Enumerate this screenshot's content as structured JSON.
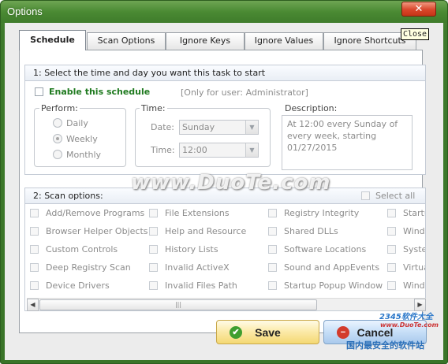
{
  "window": {
    "title": "Options",
    "close_symbol": "✕",
    "tooltip": "Close"
  },
  "tabs": [
    {
      "label": "Schedule",
      "active": true
    },
    {
      "label": "Scan Options"
    },
    {
      "label": "Ignore Keys"
    },
    {
      "label": "Ignore Values"
    },
    {
      "label": "Ignore Shortcuts"
    }
  ],
  "schedule": {
    "section_title": "1: Select the time and day you want this task to start",
    "enable_label": "Enable this schedule",
    "enable_checked": false,
    "user_note": "[Only for user: Administrator]",
    "perform": {
      "legend": "Perform:",
      "options": [
        "Daily",
        "Weekly",
        "Monthly"
      ],
      "selected": "Weekly"
    },
    "time": {
      "legend": "Time:",
      "date_label": "Date:",
      "date_value": "Sunday",
      "time_label": "Time:",
      "time_value": "12:00"
    },
    "description": {
      "legend": "Description:",
      "text": "At 12:00 every Sunday of every week, starting 01/27/2015"
    }
  },
  "scan_options": {
    "section_title": "2: Scan options:",
    "select_all_label": "Select all",
    "columns": [
      [
        "Add/Remove Programs",
        "Browser Helper Objects",
        "Custom Controls",
        "Deep Registry Scan",
        "Device Drivers"
      ],
      [
        "File Extensions",
        "Help and Resource",
        "History Lists",
        "Invalid ActiveX",
        "Invalid Files Path"
      ],
      [
        "Registry Integrity",
        "Shared DLLs",
        "Software Locations",
        "Sound and AppEvents",
        "Startup Popup Window"
      ],
      [
        "Startu",
        "Windo",
        "Syste",
        "Virtua",
        "Windo"
      ]
    ],
    "scroll_grip": "|||"
  },
  "buttons": {
    "save": "Save",
    "cancel": "Cancel",
    "save_icon": "✔",
    "cancel_icon": "−"
  },
  "watermarks": {
    "center": "www.DuoTe.com",
    "corner_brand": "2345软件大全",
    "corner_url": "www.DuoTe.com",
    "corner_slogan": "国内最安全的软件站"
  },
  "colors": {
    "accent_green": "#3e7a2c",
    "enable_label": "#1f7a1f",
    "close_red": "#d9462a"
  }
}
